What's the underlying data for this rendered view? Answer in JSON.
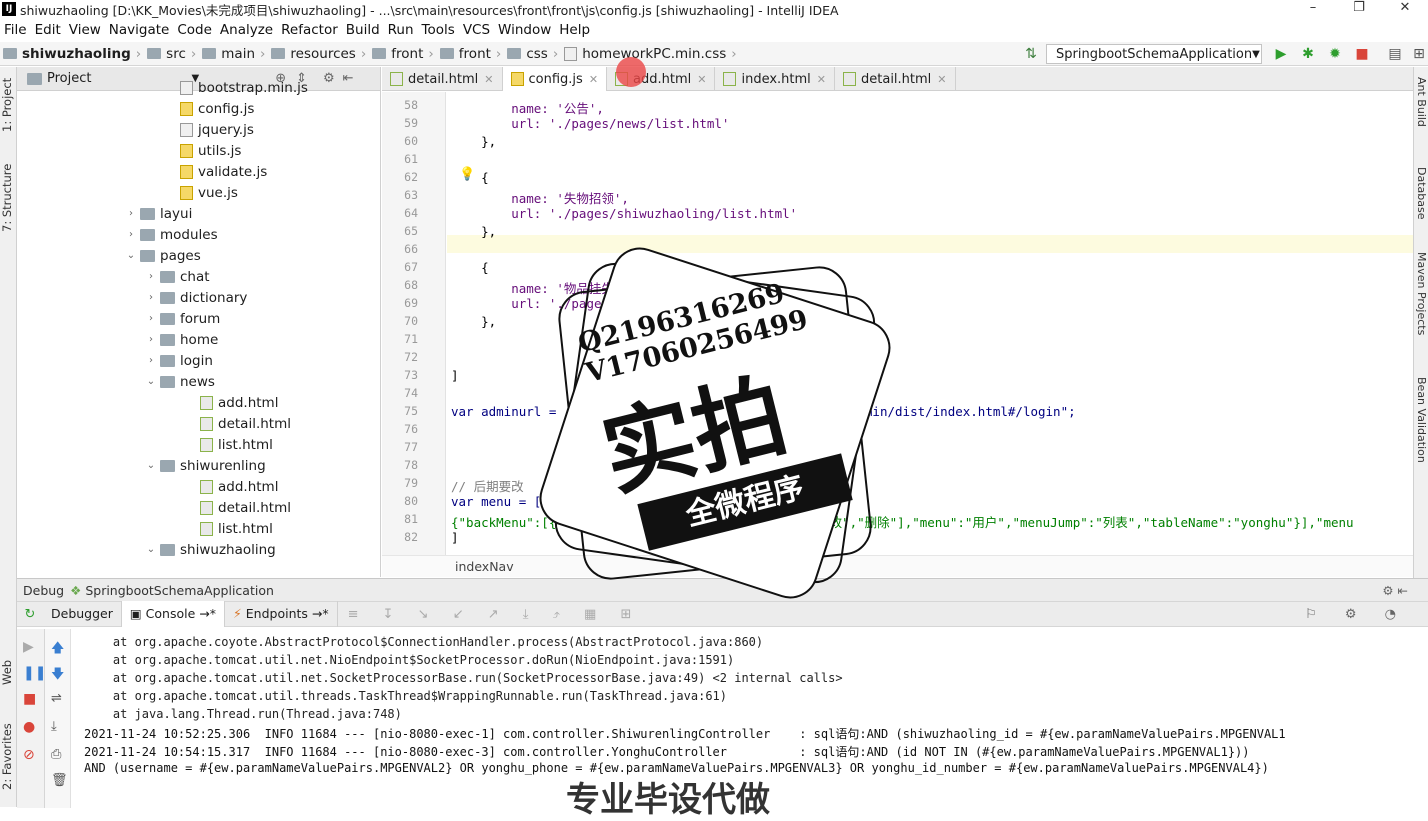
{
  "window": {
    "title": "shiwuzhaoling [D:\\KK_Movies\\未完成项目\\shiwuzhaoling] - ...\\src\\main\\resources\\front\\front\\js\\config.js [shiwuzhaoling] - IntelliJ IDEA",
    "app_icon": "IJ"
  },
  "menu": [
    "File",
    "Edit",
    "View",
    "Navigate",
    "Code",
    "Analyze",
    "Refactor",
    "Build",
    "Run",
    "Tools",
    "VCS",
    "Window",
    "Help"
  ],
  "breadcrumb": [
    "shiwuzhaoling",
    "src",
    "main",
    "resources",
    "front",
    "front",
    "css",
    "homeworkPC.min.css"
  ],
  "run_config": "SpringbootSchemaApplication",
  "left_tabs": [
    "1: Project",
    "7: Structure",
    "Web",
    "2: Favorites"
  ],
  "right_tabs": [
    "Ant Build",
    "Database",
    "Maven Projects",
    "Bean Validation"
  ],
  "project": {
    "header": "Project",
    "tree": [
      {
        "label": "bootstrap.min.js",
        "type": "min"
      },
      {
        "label": "config.js",
        "type": "js"
      },
      {
        "label": "jquery.js",
        "type": "min"
      },
      {
        "label": "utils.js",
        "type": "js"
      },
      {
        "label": "validate.js",
        "type": "js"
      },
      {
        "label": "vue.js",
        "type": "js"
      },
      {
        "label": "layui",
        "type": "folder",
        "arrow": "›"
      },
      {
        "label": "modules",
        "type": "folder",
        "arrow": "›"
      },
      {
        "label": "pages",
        "type": "folder",
        "arrow": "⌄"
      },
      {
        "label": "chat",
        "type": "folder",
        "arrow": "›"
      },
      {
        "label": "dictionary",
        "type": "folder",
        "arrow": "›"
      },
      {
        "label": "forum",
        "type": "folder",
        "arrow": "›"
      },
      {
        "label": "home",
        "type": "folder",
        "arrow": "›"
      },
      {
        "label": "login",
        "type": "folder",
        "arrow": "›"
      },
      {
        "label": "news",
        "type": "folder",
        "arrow": "⌄"
      },
      {
        "label": "add.html",
        "type": "html"
      },
      {
        "label": "detail.html",
        "type": "html"
      },
      {
        "label": "list.html",
        "type": "html"
      },
      {
        "label": "shiwurenling",
        "type": "folder",
        "arrow": "⌄"
      },
      {
        "label": "add.html",
        "type": "html"
      },
      {
        "label": "detail.html",
        "type": "html"
      },
      {
        "label": "list.html",
        "type": "html"
      },
      {
        "label": "shiwuzhaoling",
        "type": "folder",
        "arrow": "⌄"
      }
    ]
  },
  "editor_tabs": [
    {
      "label": "detail.html",
      "active": false
    },
    {
      "label": "config.js",
      "active": true
    },
    {
      "label": "add.html",
      "active": false
    },
    {
      "label": "index.html",
      "active": false
    },
    {
      "label": "detail.html",
      "active": false
    }
  ],
  "code_lines": [
    {
      "no": "58",
      "text": "        name: '公告',"
    },
    {
      "no": "59",
      "text": "        url: './pages/news/list.html'"
    },
    {
      "no": "60",
      "text": "    },"
    },
    {
      "no": "61",
      "text": ""
    },
    {
      "no": "62",
      "text": "    {"
    },
    {
      "no": "63",
      "text": "        name: '失物招领',"
    },
    {
      "no": "64",
      "text": "        url: './pages/shiwuzhaoling/list.html'"
    },
    {
      "no": "65",
      "text": "    },"
    },
    {
      "no": "66",
      "text": ""
    },
    {
      "no": "67",
      "text": "    {"
    },
    {
      "no": "68",
      "text": "        name: '物品挂失',"
    },
    {
      "no": "69",
      "text": "        url: './pages/wupinguashi/list.html'"
    },
    {
      "no": "70",
      "text": "    },"
    },
    {
      "no": "71",
      "text": ""
    },
    {
      "no": "72",
      "text": ""
    },
    {
      "no": "73",
      "text": "]"
    },
    {
      "no": "74",
      "text": ""
    },
    {
      "no": "75",
      "text": "var adminurl =  \"http://localhost:8080/shiwuzhaoling/admin/dist/index.html#/login\";"
    },
    {
      "no": "76",
      "text": ""
    },
    {
      "no": "77",
      "text": ""
    },
    {
      "no": "78",
      "text": ""
    },
    {
      "no": "79",
      "text": "// 后期要改"
    },
    {
      "no": "80",
      "text": "var menu = ["
    },
    {
      "no": "81",
      "text": "{\"backMenu\":[{\"child\":[{\"buttons\":[\"新增\",\"查看\",\"修改\",\"删除\"],\"menu\":\"用户\",\"menuJump\":\"列表\",\"tableName\":\"yonghu\"}],\"menu"
    },
    {
      "no": "82",
      "text": "]"
    }
  ],
  "editor_footer": "indexNav",
  "debug": {
    "title": "Debug",
    "config": "SpringbootSchemaApplication",
    "tabs": [
      "Debugger",
      "Console",
      "Endpoints"
    ],
    "log_lines": [
      "    at org.apache.coyote.AbstractProtocol$ConnectionHandler.process(AbstractProtocol.java:860)",
      "    at org.apache.tomcat.util.net.NioEndpoint$SocketProcessor.doRun(NioEndpoint.java:1591)",
      "    at org.apache.tomcat.util.net.SocketProcessorBase.run(SocketProcessorBase.java:49) <2 internal calls>",
      "    at org.apache.tomcat.util.threads.TaskThread$WrappingRunnable.run(TaskThread.java:61)",
      "    at java.lang.Thread.run(Thread.java:748)",
      "2021-11-24 10:52:25.306  INFO 11684 --- [nio-8080-exec-1] com.controller.ShiwurenlingController    : sql语句:AND (shiwuzhaoling_id = #{ew.paramNameValuePairs.MPGENVAL1",
      "2021-11-24 10:54:15.317  INFO 11684 --- [nio-8080-exec-3] com.controller.YonghuController          : sql语句:AND (id NOT IN (#{ew.paramNameValuePairs.MPGENVAL1}))",
      "AND (username = #{ew.paramNameValuePairs.MPGENVAL2} OR yonghu_phone = #{ew.paramNameValuePairs.MPGENVAL3} OR yonghu_id_number = #{ew.paramNameValuePairs.MPGENVAL4})"
    ]
  },
  "watermark": {
    "qq": "Q2196316269",
    "vx": "V17060256499",
    "big": "实拍",
    "band": "全微程序",
    "bottom": "专业毕设代做"
  }
}
